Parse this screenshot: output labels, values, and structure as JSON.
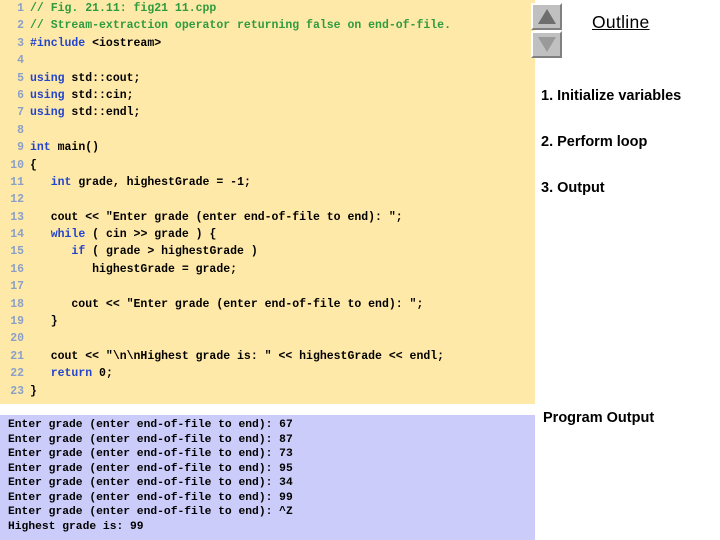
{
  "colors": {
    "code_background": "#ffe9a8",
    "output_background": "#ccccfa",
    "keyword": "#2244cc",
    "comment": "#2e9b3e",
    "line_number": "#8aa0c8",
    "page_background": "#ffffff"
  },
  "code_panel": {
    "lines": [
      {
        "num": "1",
        "tokens": [
          {
            "t": "// Fig. 21.11: fig21 11.cpp",
            "c": "cmt"
          }
        ]
      },
      {
        "num": "2",
        "tokens": [
          {
            "t": "// Stream-extraction operator returning false on end-of-file.",
            "c": "cmt"
          }
        ]
      },
      {
        "num": "3",
        "tokens": [
          {
            "t": "#include",
            "c": "kw"
          },
          {
            "t": " <iostream>",
            "c": "plain"
          }
        ]
      },
      {
        "num": "4",
        "tokens": []
      },
      {
        "num": "5",
        "tokens": [
          {
            "t": "using",
            "c": "kw"
          },
          {
            "t": " std::cout;",
            "c": "plain"
          }
        ]
      },
      {
        "num": "6",
        "tokens": [
          {
            "t": "using",
            "c": "kw"
          },
          {
            "t": " std::cin;",
            "c": "plain"
          }
        ]
      },
      {
        "num": "7",
        "tokens": [
          {
            "t": "using",
            "c": "kw"
          },
          {
            "t": " std::endl;",
            "c": "plain"
          }
        ]
      },
      {
        "num": "8",
        "tokens": []
      },
      {
        "num": "9",
        "tokens": [
          {
            "t": "int",
            "c": "kw"
          },
          {
            "t": " main()",
            "c": "plain"
          }
        ]
      },
      {
        "num": "10",
        "tokens": [
          {
            "t": "{",
            "c": "plain"
          }
        ]
      },
      {
        "num": "11",
        "tokens": [
          {
            "t": "   ",
            "c": "plain"
          },
          {
            "t": "int",
            "c": "kw"
          },
          {
            "t": " grade, highestGrade = -1;",
            "c": "plain"
          }
        ]
      },
      {
        "num": "12",
        "tokens": []
      },
      {
        "num": "13",
        "tokens": [
          {
            "t": "   cout << \"Enter grade (enter end-of-file to end): \";",
            "c": "plain"
          }
        ]
      },
      {
        "num": "14",
        "tokens": [
          {
            "t": "   ",
            "c": "plain"
          },
          {
            "t": "while",
            "c": "kw"
          },
          {
            "t": " ( cin >> grade ) {",
            "c": "plain"
          }
        ]
      },
      {
        "num": "15",
        "tokens": [
          {
            "t": "      ",
            "c": "plain"
          },
          {
            "t": "if",
            "c": "kw"
          },
          {
            "t": " ( grade > highestGrade )",
            "c": "plain"
          }
        ]
      },
      {
        "num": "16",
        "tokens": [
          {
            "t": "         highestGrade = grade;",
            "c": "plain"
          }
        ]
      },
      {
        "num": "17",
        "tokens": []
      },
      {
        "num": "18",
        "tokens": [
          {
            "t": "      cout << \"Enter grade (enter end-of-file to end): \";",
            "c": "plain"
          }
        ]
      },
      {
        "num": "19",
        "tokens": [
          {
            "t": "   }",
            "c": "plain"
          }
        ]
      },
      {
        "num": "20",
        "tokens": []
      },
      {
        "num": "21",
        "tokens": [
          {
            "t": "   cout << \"\\n\\nHighest grade is: \" << highestGrade << endl;",
            "c": "plain"
          }
        ]
      },
      {
        "num": "22",
        "tokens": [
          {
            "t": "   ",
            "c": "plain"
          },
          {
            "t": "return",
            "c": "kw"
          },
          {
            "t": " 0;",
            "c": "plain"
          }
        ]
      },
      {
        "num": "23",
        "tokens": [
          {
            "t": "}",
            "c": "plain"
          }
        ]
      }
    ]
  },
  "output_panel": {
    "lines": [
      "Enter grade (enter end-of-file to end): 67",
      "Enter grade (enter end-of-file to end): 87",
      "Enter grade (enter end-of-file to end): 73",
      "Enter grade (enter end-of-file to end): 95",
      "Enter grade (enter end-of-file to end): 34",
      "Enter grade (enter end-of-file to end): 99",
      "Enter grade (enter end-of-file to end): ^Z",
      "Highest grade is: 99"
    ]
  },
  "sidebar": {
    "scroll_up_icon": "triangle-up-icon",
    "scroll_down_icon": "triangle-down-icon",
    "outline_title": "Outline",
    "outline_items": [
      "1. Initialize variables",
      "2. Perform loop",
      "3. Output"
    ],
    "program_output_label": "Program Output"
  }
}
